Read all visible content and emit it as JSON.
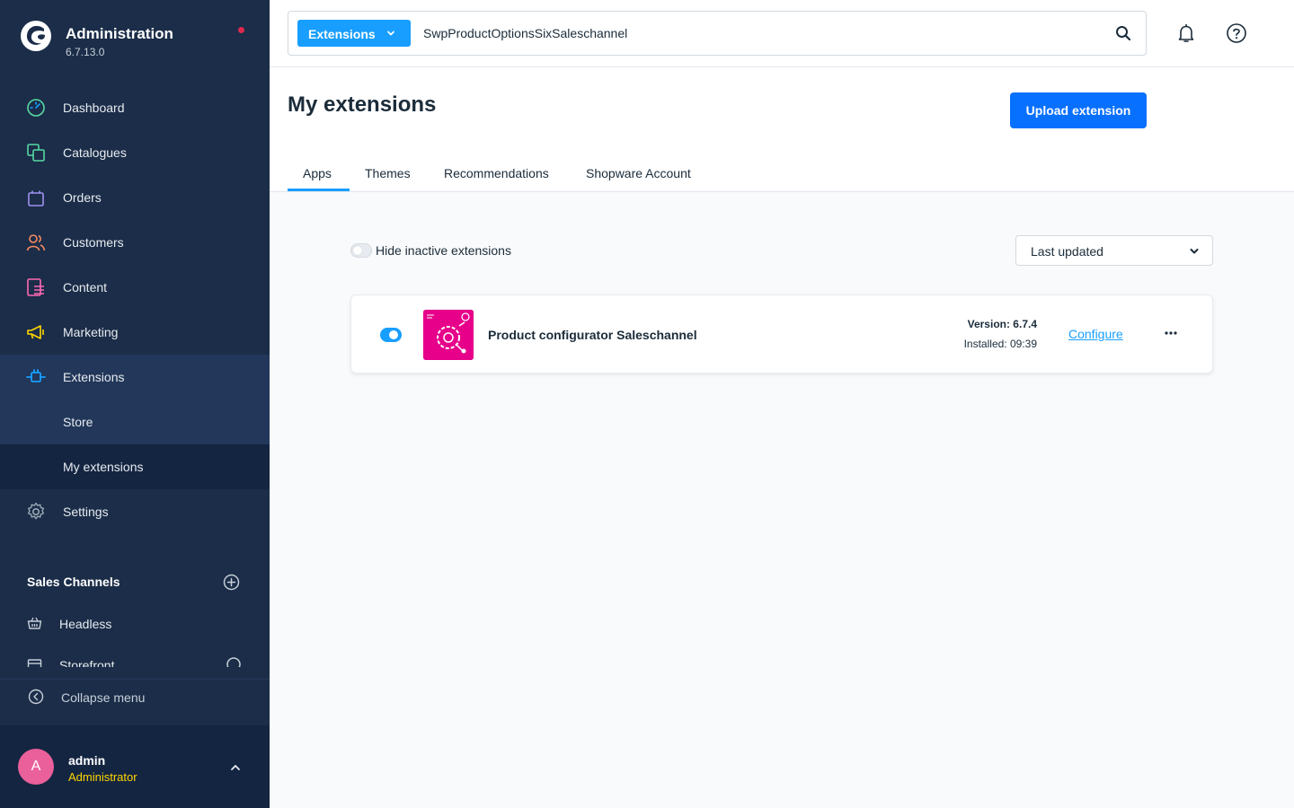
{
  "sidebar": {
    "brand": {
      "title": "Administration",
      "version": "6.7.13.0"
    },
    "nav": [
      {
        "label": "Dashboard",
        "icon": "dashboard-icon",
        "color": "#57d9a3"
      },
      {
        "label": "Catalogues",
        "icon": "catalogue-icon",
        "color": "#57d9a3"
      },
      {
        "label": "Orders",
        "icon": "orders-icon",
        "color": "#a092f0"
      },
      {
        "label": "Customers",
        "icon": "customers-icon",
        "color": "#f88962"
      },
      {
        "label": "Content",
        "icon": "content-icon",
        "color": "#ff68b4"
      },
      {
        "label": "Marketing",
        "icon": "marketing-icon",
        "color": "#ffd700"
      },
      {
        "label": "Extensions",
        "icon": "extensions-icon",
        "color": "#189eff"
      },
      {
        "label": "Store"
      },
      {
        "label": "My extensions"
      },
      {
        "label": "Settings",
        "icon": "settings-icon",
        "color": "#9aa8b5"
      }
    ],
    "sales_channels": {
      "heading": "Sales Channels",
      "items": [
        {
          "label": "Headless"
        },
        {
          "label": "Storefront"
        }
      ]
    },
    "collapse_label": "Collapse menu",
    "user": {
      "initial": "A",
      "name": "admin",
      "role": "Administrator"
    }
  },
  "topbar": {
    "search_type": "Extensions",
    "search_value": "SwpProductOptionsSixSaleschannel"
  },
  "header": {
    "title": "My extensions",
    "upload_label": "Upload extension",
    "tabs": [
      {
        "label": "Apps",
        "active": true
      },
      {
        "label": "Themes"
      },
      {
        "label": "Recommendations"
      },
      {
        "label": "Shopware Account"
      }
    ]
  },
  "filters": {
    "hide_inactive_label": "Hide inactive extensions",
    "hide_inactive": false,
    "sort_selected": "Last updated"
  },
  "extensions": [
    {
      "name": "Product configurator Saleschannel",
      "active": true,
      "version": "Version: 6.7.4",
      "installed": "Installed: 09:39",
      "configure_label": "Configure",
      "logo_color": "#e6008a"
    }
  ]
}
